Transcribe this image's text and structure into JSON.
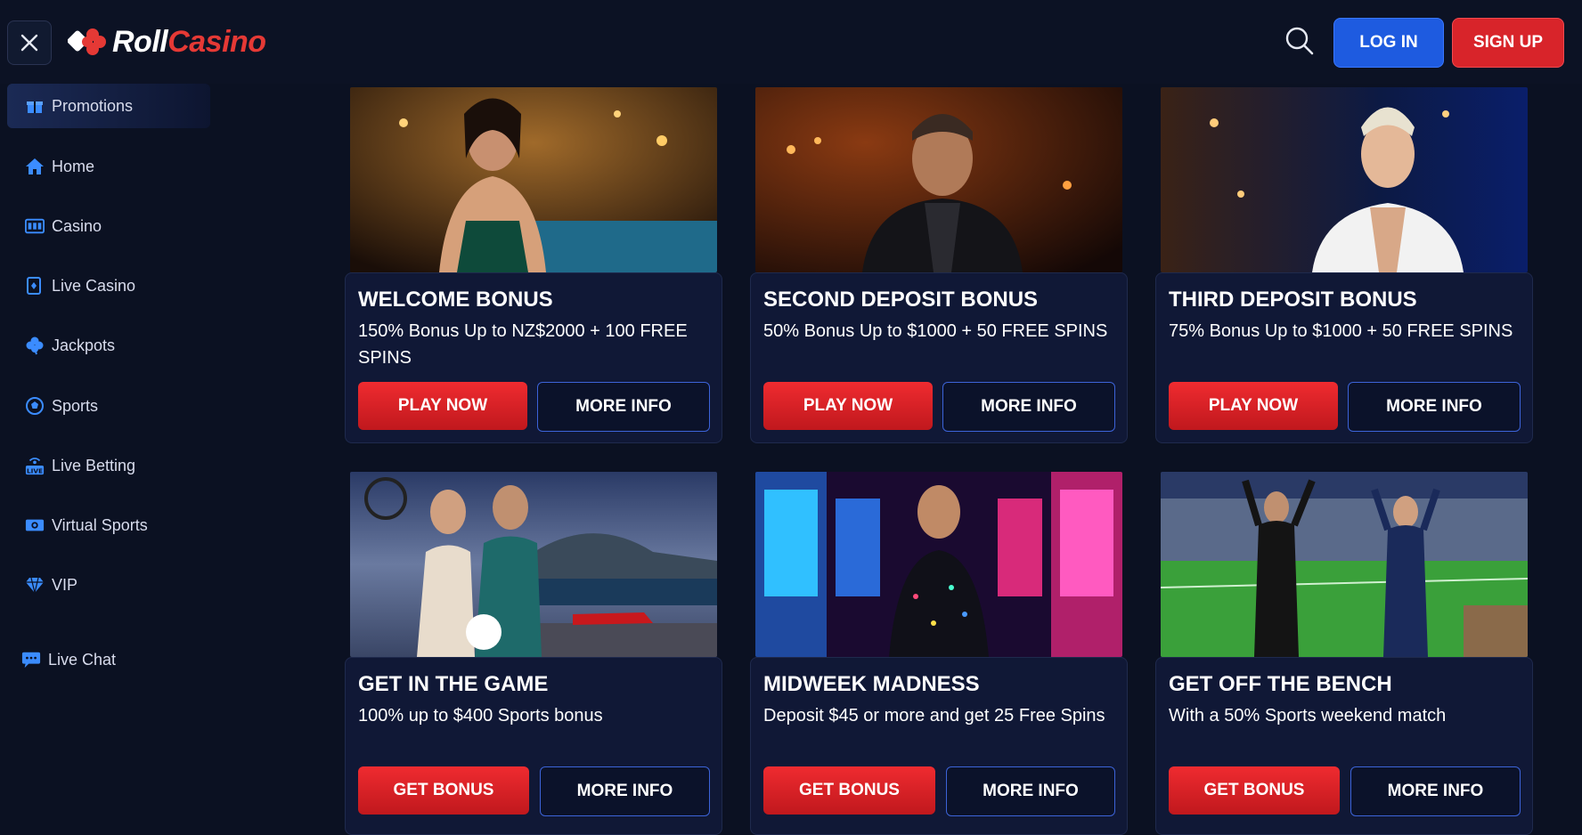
{
  "header": {
    "logo_roll": "Roll",
    "logo_casino": "Casino",
    "login_label": "LOG IN",
    "signup_label": "SIGN UP"
  },
  "sidebar": {
    "items": [
      {
        "label": "Promotions",
        "icon": "gift-icon"
      },
      {
        "label": "Home",
        "icon": "home-icon"
      },
      {
        "label": "Casino",
        "icon": "slot-machine-icon"
      },
      {
        "label": "Live Casino",
        "icon": "playing-card-icon"
      },
      {
        "label": "Jackpots",
        "icon": "clover-icon"
      },
      {
        "label": "Sports",
        "icon": "soccer-ball-icon"
      },
      {
        "label": "Live Betting",
        "icon": "live-broadcast-icon"
      },
      {
        "label": "Virtual Sports",
        "icon": "virtual-screen-icon"
      },
      {
        "label": "VIP",
        "icon": "diamond-icon"
      },
      {
        "label": "Live Chat",
        "icon": "chat-bubble-icon"
      }
    ]
  },
  "promotions": [
    {
      "title": "WELCOME BONUS",
      "description": "150% Bonus Up to NZ$2000 + 100 FREE SPINS",
      "primary": "PLAY NOW",
      "secondary": "MORE INFO"
    },
    {
      "title": "SECOND DEPOSIT BONUS",
      "description": "50% Bonus Up to $1000 + 50 FREE SPINS",
      "primary": "PLAY NOW",
      "secondary": "MORE INFO"
    },
    {
      "title": "THIRD DEPOSIT BONUS",
      "description": "75% Bonus Up to $1000 + 50 FREE SPINS",
      "primary": "PLAY NOW",
      "secondary": "MORE INFO"
    },
    {
      "title": "GET IN THE GAME",
      "description": "100% up to $400 Sports bonus",
      "primary": "GET BONUS",
      "secondary": "MORE INFO"
    },
    {
      "title": "MIDWEEK MADNESS",
      "description": "Deposit $45 or more and get 25 Free Spins",
      "primary": "GET BONUS",
      "secondary": "MORE INFO"
    },
    {
      "title": "GET OFF THE BENCH",
      "description": "With a 50% Sports weekend match",
      "primary": "GET BONUS",
      "secondary": "MORE INFO"
    }
  ],
  "colors": {
    "background": "#0b1122",
    "accent_red": "#d8242a",
    "accent_blue": "#1e5be0",
    "card_bg": "#101836",
    "sidebar_icon": "#3b8cff"
  }
}
